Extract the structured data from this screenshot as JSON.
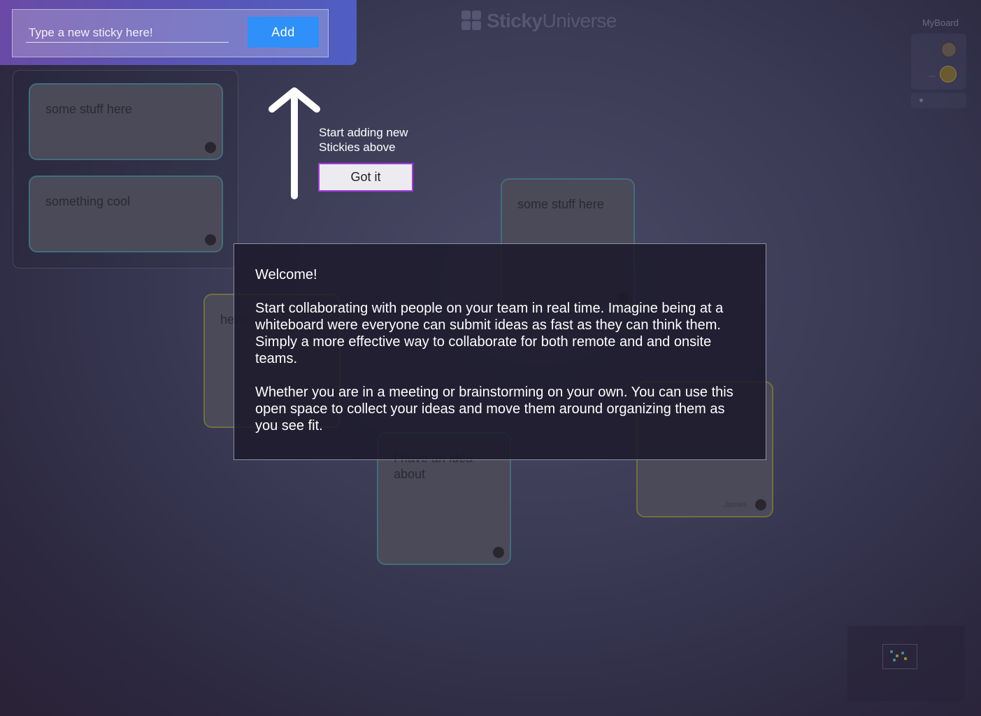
{
  "app": {
    "logo_bold": "Sticky",
    "logo_light": "Universe"
  },
  "board": {
    "label": "MyBoard"
  },
  "users": {
    "dots": "..."
  },
  "add_bar": {
    "placeholder": "Type a new sticky here!",
    "add_label": "Add"
  },
  "stack": {
    "items": [
      {
        "text": "some stuff here"
      },
      {
        "text": "something cool"
      }
    ]
  },
  "board_stickies": [
    {
      "text": "some stuff here"
    },
    {
      "text": "hello"
    },
    {
      "text": "I have an idea about"
    },
    {
      "text": "",
      "author": "James"
    }
  ],
  "onboarding": {
    "hint_line1": "Start adding new",
    "hint_line2": "Stickies above",
    "got_it_label": "Got it"
  },
  "welcome": {
    "heading": "Welcome!",
    "paragraph1": "Start collaborating with people on your team in real time.  Imagine being at a whiteboard were everyone can submit ideas as fast as they can think them. Simply a more effective way to collaborate for both remote and and onsite teams.",
    "paragraph2": "Whether you are in a meeting or brainstorming on your own. You can use this open space to collect your ideas and move them around organizing them as you see fit."
  },
  "colors": {
    "add_button": "#2e90f8",
    "got_it_border": "#a23be0",
    "accent_gradient_start": "#6a4aa6",
    "accent_gradient_end": "#4f5fc2"
  }
}
